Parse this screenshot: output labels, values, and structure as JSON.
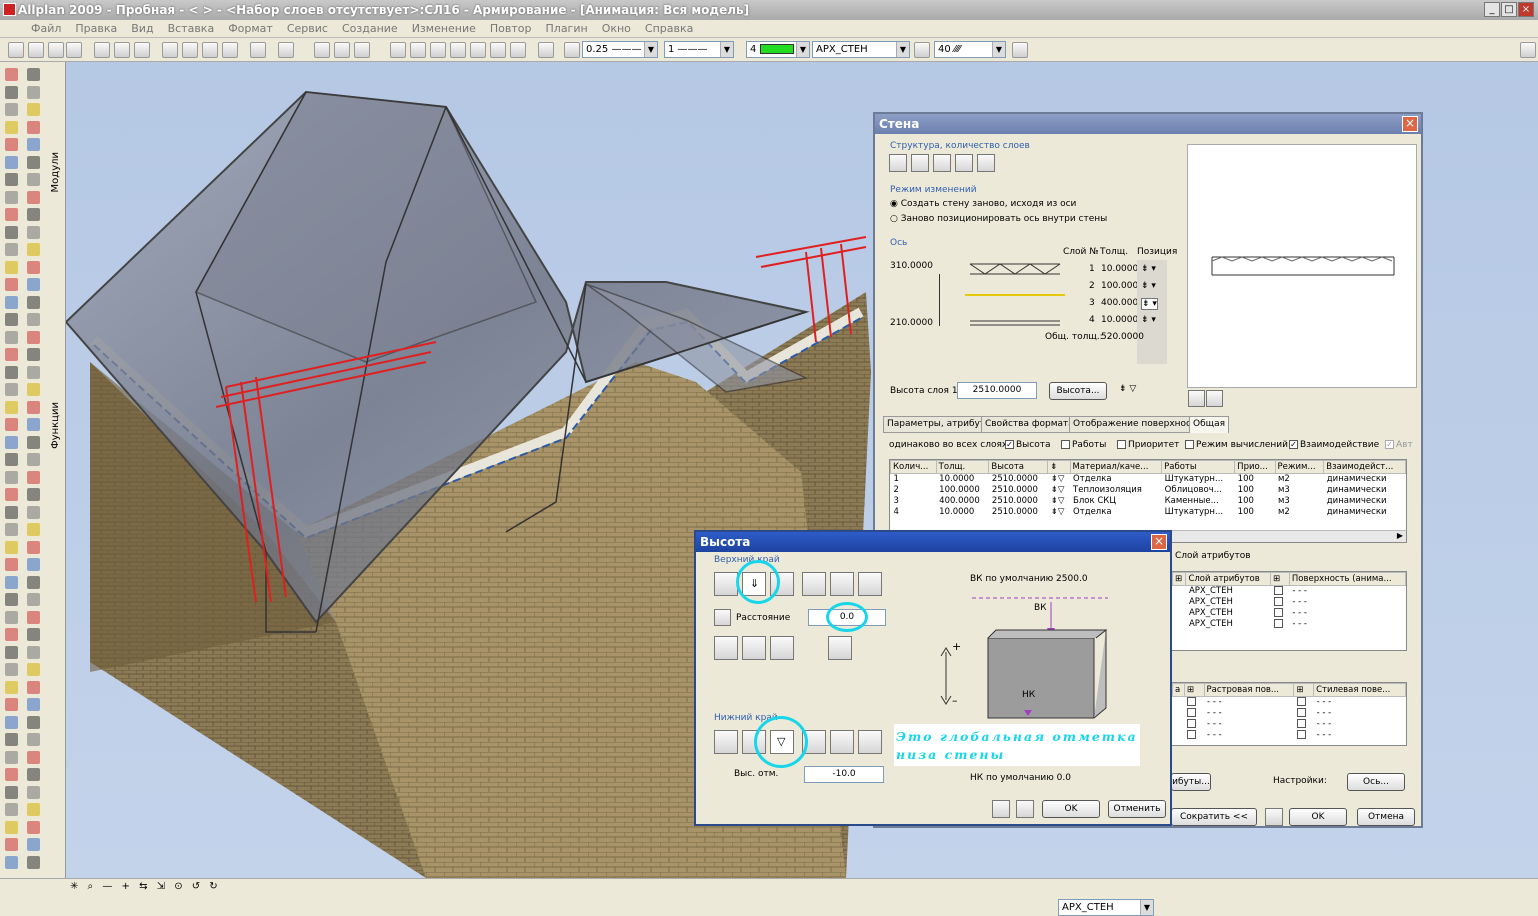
{
  "window": {
    "title": "Allplan 2009 - Пробная - <       > - <Набор слоев отсутствует>:СЛ16 - Армирование - [Анимация: Вся модель]"
  },
  "menu": [
    "Файл",
    "Правка",
    "Вид",
    "Вставка",
    "Формат",
    "Сервис",
    "Создание",
    "Изменение",
    "Повтор",
    "Плагин",
    "Окно",
    "Справка"
  ],
  "toolbar": {
    "pen": "0.25",
    "line": "1",
    "color": "4",
    "layer": "АРХ_СТЕН",
    "hatch": "40"
  },
  "side_tabs": {
    "modules": "Модули",
    "functions": "Функции"
  },
  "wall_dialog": {
    "title": "Стена",
    "structure_label": "Структура, количество слоев",
    "mode_label": "Режим изменений",
    "radio1": "Создать стену заново, исходя из оси",
    "radio2": "Заново позиционировать ось внутри стены",
    "axis_label": "Ось",
    "coord_top": "310.0000",
    "coord_bottom": "210.0000",
    "col_layer_no": "Слой №",
    "col_thickness": "Толщ.",
    "col_position": "Позиция",
    "layers": [
      {
        "no": "1",
        "thickness": "10.0000"
      },
      {
        "no": "2",
        "thickness": "100.0000"
      },
      {
        "no": "3",
        "thickness": "400.0000"
      },
      {
        "no": "4",
        "thickness": "10.0000"
      }
    ],
    "total_label": "Общ. толщ.:",
    "total_value": "520.0000",
    "layer_height_label": "Высота слоя 1:",
    "layer_height_value": "2510.0000",
    "height_button": "Высота...",
    "tabs": [
      "Параметры, атрибуты",
      "Свойства формата",
      "Отображение поверхности",
      "Общая"
    ],
    "same_label": "одинаково во всех слоях:",
    "checks": [
      {
        "label": "Высота",
        "checked": true
      },
      {
        "label": "Работы",
        "checked": false
      },
      {
        "label": "Приоритет",
        "checked": false
      },
      {
        "label": "Режим вычислений",
        "checked": false
      },
      {
        "label": "Взаимодействие",
        "checked": true
      },
      {
        "label": "Авт",
        "checked": true
      }
    ],
    "table_headers": [
      "Колич...",
      "Толщ.",
      "Высота",
      "",
      "Материал/каче...",
      "Работы",
      "Прио...",
      "Режим...",
      "Взаимодейст..."
    ],
    "table_rows": [
      [
        "1",
        "10.0000",
        "2510.0000",
        "Отделка",
        "Штукатурн...",
        "100",
        "м2",
        "динамически"
      ],
      [
        "2",
        "100.0000",
        "2510.0000",
        "Теплоизоляция",
        "Облицовоч...",
        "100",
        "м3",
        "динамически"
      ],
      [
        "3",
        "400.0000",
        "2510.0000",
        "Блок СКЦ",
        "Каменные...",
        "100",
        "м3",
        "динамически"
      ],
      [
        "4",
        "10.0000",
        "2510.0000",
        "Отделка",
        "Штукатурн...",
        "100",
        "м2",
        "динамически"
      ]
    ],
    "attr_layer_label": "Слой атрибутов",
    "attr_headers": [
      "Слой атрибутов",
      "Поверхность (анима..."
    ],
    "attr_rows": [
      "АРХ_СТЕН",
      "АРХ_СТЕН",
      "АРХ_СТЕН",
      "АРХ_СТЕН"
    ],
    "attr_dash": "- - -",
    "surf_headers": [
      "а",
      "Растровая пов...",
      "Стилевая пове..."
    ],
    "bottom_btn_partial": "ибуты...",
    "settings_label": "Настройки:",
    "axis_button": "Ось...",
    "reduce_button": "Сократить <<",
    "ok": "OK",
    "cancel": "Отмена"
  },
  "height_dialog": {
    "title": "Высота",
    "top_edge_label": "Верхний край",
    "distance_label": "Расстояние",
    "distance_value": "0.0",
    "bottom_edge_label": "Нижний край",
    "abs_elev_label": "Выс. отм.",
    "abs_elev_value": "-10.0",
    "top_default": "ВК по умолчанию  2500.0",
    "bottom_default": "НК по умолчанию  0.0",
    "vk_label": "ВК",
    "nk_label": "НК",
    "annotation": "Это глобальная отметка низа стены",
    "ok": "OK",
    "cancel": "Отменить"
  },
  "status": {
    "layer": "АРХ_СТЕН"
  },
  "colors": {
    "title_gradient": "#6b7fae",
    "dialog_bg": "#ece9d8",
    "annotation": "#18d6ea",
    "brick": "#a89468",
    "rebar": "#e02020"
  }
}
